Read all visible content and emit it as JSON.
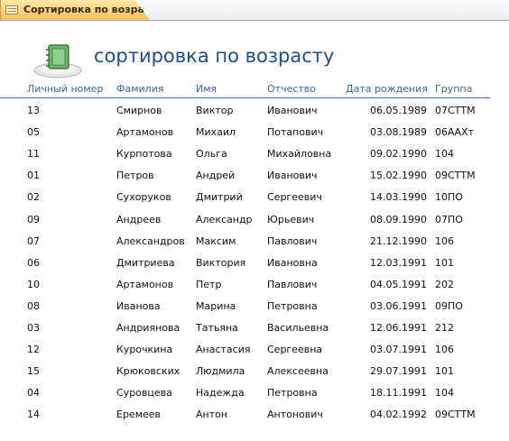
{
  "tab": {
    "label": "Сортировка по возрасту",
    "icon": "report-icon"
  },
  "report": {
    "title": "сортировка по возрасту",
    "icon": "notebook-icon"
  },
  "columns": [
    "Личный номер",
    "Фамилия",
    "Имя",
    "Отчество",
    "Дата рождения",
    "Группа"
  ],
  "rows": [
    [
      "13",
      "Смирнов",
      "Виктор",
      "Иванович",
      "06.05.1989",
      "07СТТМ"
    ],
    [
      "05",
      "Артамонов",
      "Михаил",
      "Потапович",
      "03.08.1989",
      "06ААХт"
    ],
    [
      "11",
      "Курпотова",
      "Ольга",
      "Михайловна",
      "09.02.1990",
      "104"
    ],
    [
      "01",
      "Петров",
      "Андрей",
      "Иванович",
      "15.02.1990",
      "09СТТМ"
    ],
    [
      "02",
      "Сухоруков",
      "Дмитрий",
      "Сергеевич",
      "14.03.1990",
      "10ПО"
    ],
    [
      "09",
      "Андреев",
      "Александр",
      "Юрьевич",
      "08.09.1990",
      "07ПО"
    ],
    [
      "07",
      "Александров",
      "Максим",
      "Павлович",
      "21.12.1990",
      "106"
    ],
    [
      "06",
      "Дмитриева",
      "Виктория",
      "Ивановна",
      "12.03.1991",
      "101"
    ],
    [
      "10",
      "Артамонов",
      "Петр",
      "Павлович",
      "04.05.1991",
      "202"
    ],
    [
      "08",
      "Иванова",
      "Марина",
      "Петровна",
      "03.06.1991",
      "09ПО"
    ],
    [
      "03",
      "Андриянова",
      "Татьяна",
      "Васильевна",
      "12.06.1991",
      "212"
    ],
    [
      "12",
      "Курочкина",
      "Анастасия",
      "Сергеевна",
      "03.07.1991",
      "106"
    ],
    [
      "15",
      "Крюковских",
      "Людмила",
      "Алексеевна",
      "29.07.1991",
      "101"
    ],
    [
      "04",
      "Суровцева",
      "Надежда",
      "Петровна",
      "18.11.1991",
      "104"
    ],
    [
      "14",
      "Еремеев",
      "Антон",
      "Антонович",
      "04.02.1992",
      "09СТТМ"
    ]
  ]
}
